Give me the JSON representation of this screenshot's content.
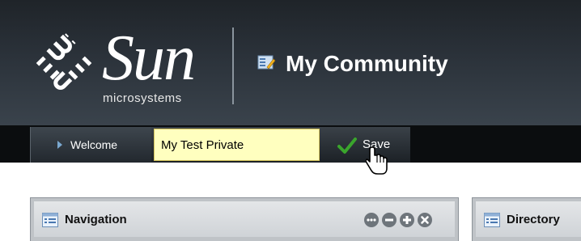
{
  "brand": {
    "wordmark": "Sun",
    "tagline": "microsystems"
  },
  "header": {
    "title": "My Community",
    "icon": "community-icon"
  },
  "nav": {
    "welcome_tab": "Welcome",
    "edit_tab": {
      "input_value": "My Test Private",
      "save_label": "Save"
    }
  },
  "portlets": [
    {
      "title": "Navigation",
      "controls": [
        "more-icon",
        "minimize-icon",
        "maximize-icon",
        "close-icon"
      ]
    },
    {
      "title": "Directory"
    }
  ],
  "colors": {
    "header_bg": "#2b323a",
    "navbar_bg": "#0b0d0f",
    "input_bg": "#ffffbf",
    "check_green": "#3aa52c",
    "portlet_frame": "#bfc3c7"
  }
}
